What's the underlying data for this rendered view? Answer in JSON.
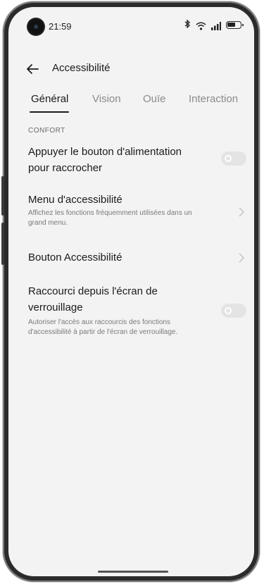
{
  "status_bar": {
    "time": "21:59",
    "bluetooth_icon": "bluetooth-icon",
    "wifi_icon": "wifi-icon",
    "signal_icon": "signal-icon",
    "battery_icon": "battery-icon"
  },
  "header": {
    "title": "Accessibilité",
    "back_icon": "back-arrow-icon"
  },
  "tabs": [
    {
      "label": "Général",
      "active": true
    },
    {
      "label": "Vision",
      "active": false
    },
    {
      "label": "Ouïe",
      "active": false
    },
    {
      "label": "Interaction",
      "active": false
    }
  ],
  "section": {
    "label": "CONFORT"
  },
  "rows": [
    {
      "title_line1": "Appuyer le bouton d'alimentation",
      "title_line2": "pour raccrocher",
      "toggle_on": false
    },
    {
      "title": "Menu d'accessibilité",
      "desc_line1": "Affichez les fonctions fréquemment utilisées dans un",
      "desc_line2": "grand menu."
    },
    {
      "title": "Bouton Accessibilité"
    },
    {
      "title_line1": "Raccourci depuis l'écran de",
      "title_line2": "verrouillage",
      "desc_line1": "Autoriser l'accès aux raccourcis des fonctions",
      "desc_line2": "d'accessibilité à partir de l'écran de verrouillage.",
      "toggle_on": false
    }
  ],
  "colors": {
    "background": "#f3f3f3",
    "toggle_off": "#e4e4e4",
    "text": "#1a1a1a"
  }
}
